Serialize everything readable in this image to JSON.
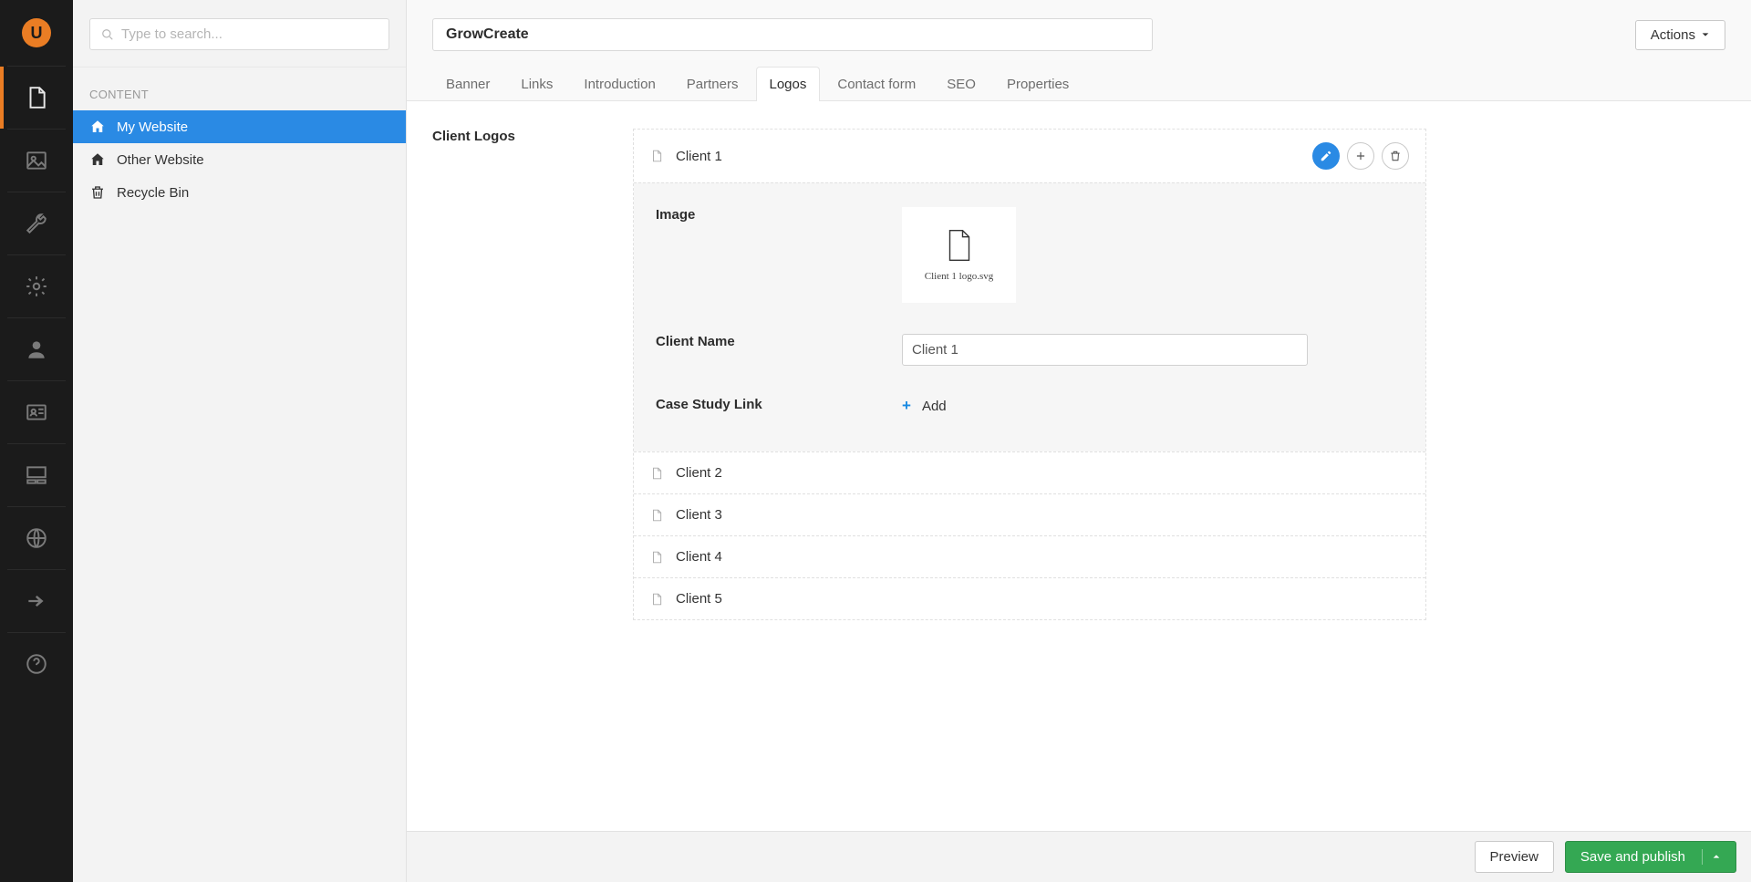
{
  "search": {
    "placeholder": "Type to search..."
  },
  "tree": {
    "section_label": "CONTENT",
    "items": [
      {
        "label": "My Website",
        "icon": "home",
        "active": true
      },
      {
        "label": "Other Website",
        "icon": "home",
        "active": false
      },
      {
        "label": "Recycle Bin",
        "icon": "trash",
        "active": false
      }
    ]
  },
  "header": {
    "node_name": "GrowCreate",
    "actions_label": "Actions"
  },
  "tabs": [
    {
      "label": "Banner",
      "active": false
    },
    {
      "label": "Links",
      "active": false
    },
    {
      "label": "Introduction",
      "active": false
    },
    {
      "label": "Partners",
      "active": false
    },
    {
      "label": "Logos",
      "active": true
    },
    {
      "label": "Contact form",
      "active": false
    },
    {
      "label": "SEO",
      "active": false
    },
    {
      "label": "Properties",
      "active": false
    }
  ],
  "group": {
    "label": "Client Logos"
  },
  "logos": {
    "expanded": {
      "title": "Client 1",
      "image_label": "Image",
      "image_filename": "Client 1 logo.svg",
      "client_name_label": "Client Name",
      "client_name_value": "Client 1",
      "case_study_label": "Case Study Link",
      "case_study_add": "Add"
    },
    "collapsed": [
      {
        "title": "Client 2"
      },
      {
        "title": "Client 3"
      },
      {
        "title": "Client 4"
      },
      {
        "title": "Client 5"
      }
    ]
  },
  "footer": {
    "preview": "Preview",
    "publish": "Save and publish"
  }
}
